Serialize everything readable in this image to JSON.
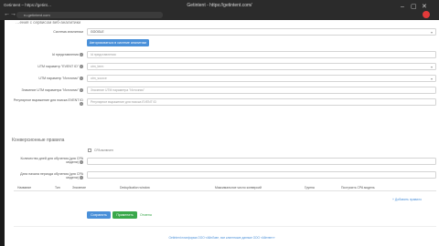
{
  "browser": {
    "tab_title": "Getintent – https://getint…",
    "url": "ru.getintent.com",
    "window_title": "Getintent - https://getintent.com/",
    "controls": [
      "←",
      "→",
      "↻"
    ],
    "window_buttons": [
      "–",
      "▢",
      "✕"
    ]
  },
  "form": {
    "section_top": "…ения с сервисом веб-аналитики",
    "analytics_system": {
      "label": "Система аналитики",
      "value": "GOOGLE"
    },
    "connect_button": "Авторизоваться в системе аналитики",
    "id_field": {
      "label": "Id представления",
      "placeholder": "Id представления"
    },
    "utm_event_id": {
      "label": "UTM параметр \"EVENT ID\"",
      "value": "utm_term"
    },
    "utm_source": {
      "label": "UTM параметр \"Источник\"",
      "value": "utm_source"
    },
    "utm_source_value": {
      "label": "Значение UTM параметра \"Источник\"",
      "placeholder": "Значение UTM параметра \"Источник\""
    },
    "regex": {
      "label": "Регулярное выражение для поиска EVENT ID",
      "placeholder": "Регулярное выражение для поиска EVENT ID"
    }
  },
  "conversion": {
    "title": "Конверсионные правила",
    "cpa_checkbox_label": "CPA включен",
    "days_training": {
      "label": "Количество дней для обучения (для CPA модели)"
    },
    "start_date": {
      "label": "Дата начала периода обучения (для CPA модели)"
    },
    "table_headers": [
      "Название",
      "Тип",
      "Значение",
      "Deduplication window",
      "Максимальное число конверсий",
      "Группа",
      "Построить CPA модель"
    ],
    "add_rule": "+ Добавить правило"
  },
  "actions": {
    "save": "Сохранить",
    "apply": "Применить",
    "cancel": "Отмена"
  },
  "footer": "GetIntent платформа ООО «АйнЛав», все клиентские данные ООО «Айнтент»",
  "colors": {
    "primary": "#4a90d9",
    "success": "#3aa84b",
    "chrome": "#2b2b2b"
  }
}
